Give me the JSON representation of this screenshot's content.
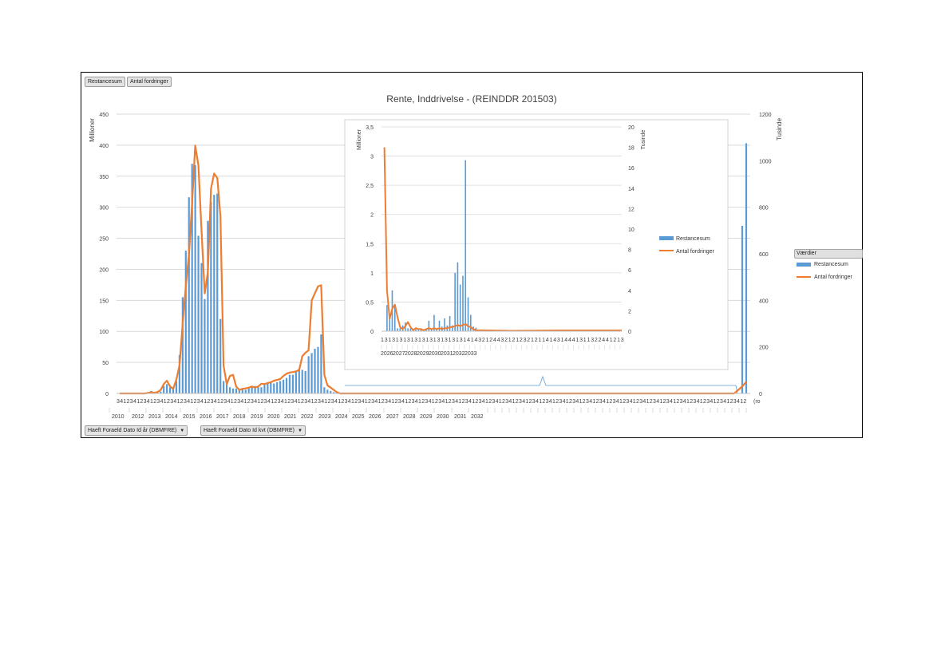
{
  "filters": {
    "top": [
      "Restancesum",
      "Antal fordringer"
    ],
    "bottom": [
      "Haeft Foraeld Dato Id år (DBMFRE)",
      "Haeft Foraeld Dato Id kvt (DBMFRE)"
    ]
  },
  "colors": {
    "bar": "#5b9bd5",
    "line": "#ed7d31",
    "grid": "#d9d9d9",
    "axis": "#595959"
  },
  "legend": {
    "title": "Værdier",
    "items": [
      "Restancesum",
      "Antal fordringer"
    ]
  },
  "chart_data": [
    {
      "type": "bar",
      "title": "Rente, Inddrivelse - (REINDDR 201503)",
      "ylabel": "Millioner",
      "y2label": "Tusinde",
      "ylim": [
        0,
        450
      ],
      "y2lim": [
        0,
        1200
      ],
      "yticks": [
        "0",
        "50",
        "100",
        "150",
        "200",
        "250",
        "300",
        "350",
        "400",
        "450"
      ],
      "y2ticks": [
        "0",
        "200",
        "400",
        "600",
        "800",
        "1000",
        "1200"
      ],
      "year_labels": [
        "2010",
        "2012",
        "2013",
        "2014",
        "2015",
        "2016",
        "2017",
        "2018",
        "2019",
        "2020",
        "2021",
        "2022",
        "2023",
        "2024",
        "2025",
        "2026",
        "2027",
        "2028",
        "2029",
        "2030",
        "2031",
        "2032",
        "2033"
      ],
      "bar_values": [
        0,
        0,
        0,
        0,
        0,
        0,
        0,
        0,
        1,
        2,
        4,
        2,
        3,
        3,
        12,
        15,
        10,
        8,
        20,
        62,
        155,
        230,
        316,
        370,
        368,
        254,
        210,
        152,
        278,
        308,
        320,
        322,
        120,
        20,
        18,
        10,
        8,
        8,
        6,
        8,
        6,
        8,
        12,
        12,
        10,
        10,
        14,
        16,
        18,
        16,
        18,
        20,
        22,
        25,
        30,
        30,
        35,
        40,
        38,
        36,
        60,
        65,
        72,
        75,
        95,
        10,
        6,
        4,
        2,
        1,
        1,
        0
      ],
      "line_values": [
        0,
        0,
        0,
        0,
        0,
        0,
        0,
        0,
        0,
        2,
        5,
        3,
        6,
        15,
        40,
        55,
        30,
        20,
        60,
        120,
        300,
        460,
        600,
        820,
        1065,
        980,
        700,
        430,
        520,
        880,
        945,
        925,
        760,
        120,
        40,
        75,
        80,
        30,
        15,
        20,
        22,
        25,
        30,
        25,
        30,
        42,
        40,
        45,
        48,
        55,
        58,
        62,
        75,
        85,
        90,
        92,
        95,
        100,
        160,
        175,
        185,
        400,
        430,
        460,
        465,
        80,
        35,
        25,
        15,
        5,
        0,
        0
      ],
      "tail_bar_values": [
        720,
        1075
      ],
      "tail_line_values": [
        30,
        50
      ]
    },
    {
      "type": "bar",
      "ylabel": "Millioner",
      "y2label": "Tusinde",
      "ylim": [
        0,
        3.5
      ],
      "y2lim": [
        0,
        20
      ],
      "yticks": [
        "0",
        "0,5",
        "1",
        "1,5",
        "2",
        "2,5",
        "3",
        "3,5"
      ],
      "y2ticks": [
        "0",
        "2",
        "4",
        "6",
        "8",
        "10",
        "12",
        "14",
        "16",
        "18",
        "20"
      ],
      "year_labels": [
        "2026",
        "2027",
        "2028",
        "2029",
        "2030",
        "2031",
        "2032",
        "2033"
      ],
      "bar_values": [
        0.0,
        0.45,
        0.2,
        0.7,
        0.42,
        0.05,
        0.05,
        0.1,
        0.15,
        0.05,
        0.05,
        0.04,
        0.03,
        0.03,
        0.05,
        0.03,
        0.04,
        0.18,
        0.04,
        0.28,
        0.05,
        0.18,
        0.08,
        0.22,
        0.1,
        0.26,
        0.1,
        1.0,
        1.18,
        0.8,
        0.95,
        2.93,
        0.58,
        0.28,
        0.08,
        0.06
      ],
      "line_values": [
        18.0,
        4.0,
        1.2,
        2.2,
        2.6,
        1.4,
        0.4,
        0.2,
        0.5,
        0.9,
        0.4,
        0.1,
        0.3,
        0.2,
        0.2,
        0.1,
        0.2,
        0.3,
        0.2,
        0.3,
        0.2,
        0.3,
        0.2,
        0.3,
        0.3,
        0.4,
        0.4,
        0.5,
        0.6,
        0.5,
        0.6,
        0.7,
        0.5,
        0.4,
        0.2,
        0.1
      ]
    }
  ],
  "insert_legend": [
    "Restancesum",
    "Antal fordringer"
  ]
}
